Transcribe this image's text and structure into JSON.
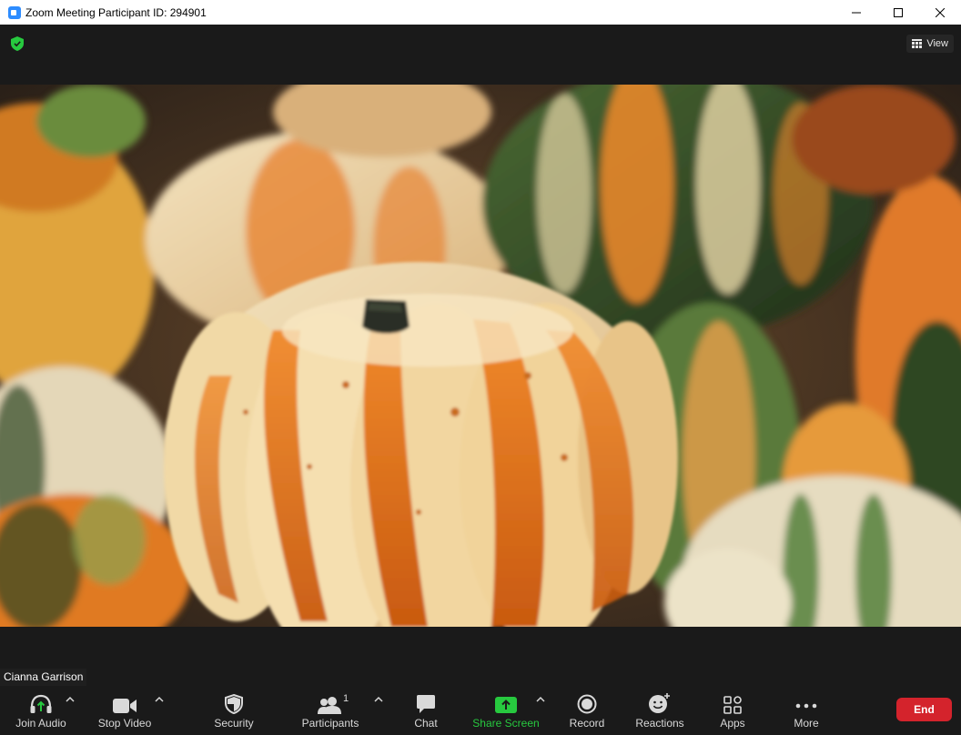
{
  "window": {
    "title": "Zoom Meeting Participant ID: 294901"
  },
  "topbar": {
    "view_label": "View"
  },
  "video": {
    "participant_name": "Cianna Garrison"
  },
  "toolbar": {
    "join_audio": "Join Audio",
    "stop_video": "Stop Video",
    "security": "Security",
    "participants": "Participants",
    "participants_count": "1",
    "chat": "Chat",
    "share_screen": "Share Screen",
    "record": "Record",
    "reactions": "Reactions",
    "apps": "Apps",
    "more": "More",
    "end": "End"
  },
  "colors": {
    "accent_green": "#27c93f",
    "end_red": "#d4232c",
    "zoom_blue": "#2d8cff"
  }
}
